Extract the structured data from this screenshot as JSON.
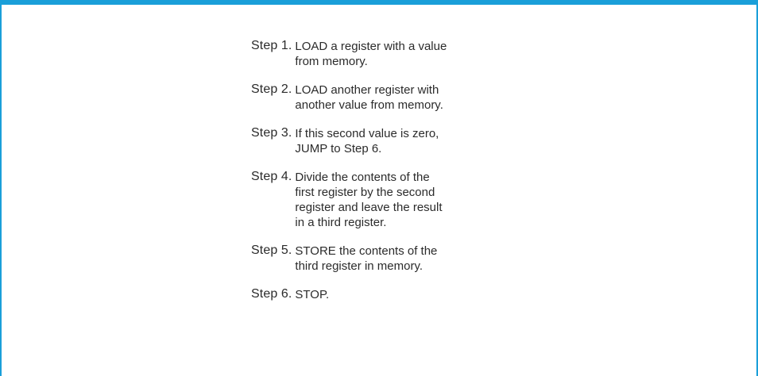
{
  "accent_color": "#1a9fd9",
  "steps": [
    {
      "label": "Step 1.",
      "text": "LOAD a register with a value\nfrom memory."
    },
    {
      "label": "Step 2.",
      "text": "LOAD another register with\nanother value from memory."
    },
    {
      "label": "Step 3.",
      "text": "If this second value is zero,\nJUMP to Step 6."
    },
    {
      "label": "Step 4.",
      "text": "Divide the contents of the\nfirst register by the second\nregister and leave the result\nin a third register."
    },
    {
      "label": "Step 5.",
      "text": "STORE the contents of the\nthird register in memory."
    },
    {
      "label": "Step 6.",
      "text": "STOP."
    }
  ]
}
